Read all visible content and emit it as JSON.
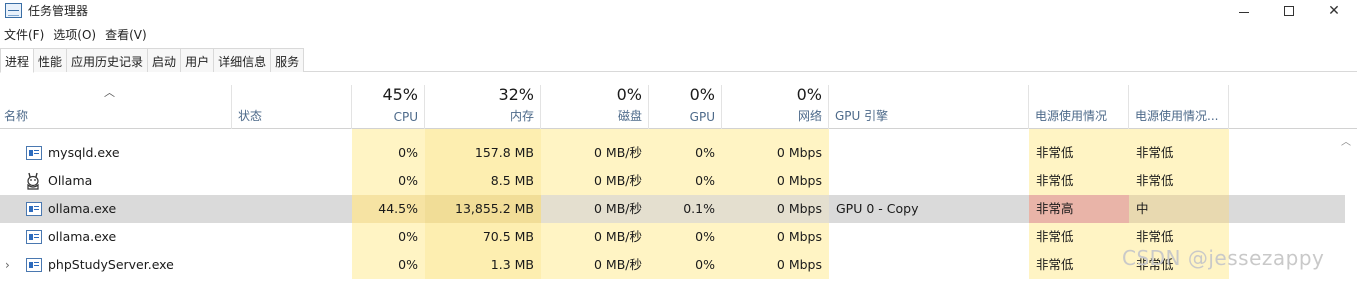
{
  "window": {
    "title": "任务管理器"
  },
  "menu": [
    "文件(F)",
    "选项(O)",
    "查看(V)"
  ],
  "tabs": [
    "进程",
    "性能",
    "应用历史记录",
    "启动",
    "用户",
    "详细信息",
    "服务"
  ],
  "columns": {
    "name": "名称",
    "status": "状态",
    "cpu": {
      "pct": "45%",
      "label": "CPU"
    },
    "mem": {
      "pct": "32%",
      "label": "内存"
    },
    "disk": {
      "pct": "0%",
      "label": "磁盘"
    },
    "gpu": {
      "pct": "0%",
      "label": "GPU"
    },
    "net": {
      "pct": "0%",
      "label": "网络"
    },
    "gpu_engine": "GPU 引擎",
    "power": "电源使用情况",
    "power_trend": "电源使用情况..."
  },
  "rows": [
    {
      "name": "mysqld.exe",
      "cpu": "0%",
      "mem": "157.8 MB",
      "disk": "0 MB/秒",
      "gpu": "0%",
      "net": "0 Mbps",
      "gpu_engine": "",
      "power": "非常低",
      "power_trend": "非常低"
    },
    {
      "name": "Ollama",
      "cpu": "0%",
      "mem": "8.5 MB",
      "disk": "0 MB/秒",
      "gpu": "0%",
      "net": "0 Mbps",
      "gpu_engine": "",
      "power": "非常低",
      "power_trend": "非常低"
    },
    {
      "name": "ollama.exe",
      "cpu": "44.5%",
      "mem": "13,855.2 MB",
      "disk": "0 MB/秒",
      "gpu": "0.1%",
      "net": "0 Mbps",
      "gpu_engine": "GPU 0 - Copy",
      "power": "非常高",
      "power_trend": "中"
    },
    {
      "name": "ollama.exe",
      "cpu": "0%",
      "mem": "70.5 MB",
      "disk": "0 MB/秒",
      "gpu": "0%",
      "net": "0 Mbps",
      "gpu_engine": "",
      "power": "非常低",
      "power_trend": "非常低"
    },
    {
      "name": "phpStudyServer.exe",
      "cpu": "0%",
      "mem": "1.3 MB",
      "disk": "0 MB/秒",
      "gpu": "0%",
      "net": "0 Mbps",
      "gpu_engine": "",
      "power": "非常低",
      "power_trend": "非常低"
    }
  ],
  "watermark": "CSDN @jessezappy",
  "colors": {
    "heat_light": "#fff4c4",
    "heat_medium": "#fdeeb0",
    "heat_strong": "#f9e79b",
    "selected_row": "#dadada",
    "power_high": "#e9b4a8",
    "header_label": "#4d6a8a"
  },
  "icons": {
    "app": "task-manager-icon",
    "process": "app-window-icon",
    "ollama": "llama-icon",
    "expand": "chevron-right-icon",
    "sort": "sort-up-icon"
  }
}
